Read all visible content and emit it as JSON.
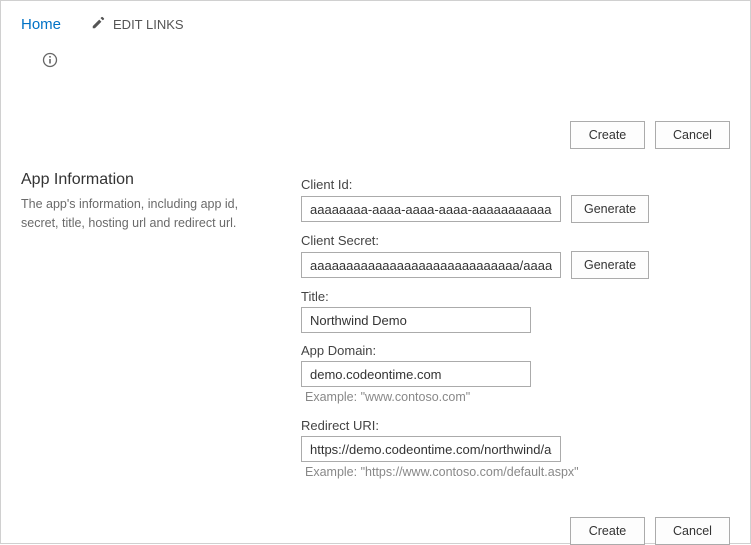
{
  "nav": {
    "home": "Home",
    "edit_links": "EDIT LINKS"
  },
  "buttons": {
    "create": "Create",
    "cancel": "Cancel",
    "generate": "Generate"
  },
  "section": {
    "title": "App Information",
    "description": "The app's information, including app id, secret, title, hosting url and redirect url."
  },
  "form": {
    "client_id": {
      "label": "Client Id:",
      "value": "aaaaaaaa-aaaa-aaaa-aaaa-aaaaaaaaaaaa"
    },
    "client_secret": {
      "label": "Client Secret:",
      "value": "aaaaaaaaaaaaaaaaaaaaaaaaaaaaa/aaaaaaaaaa"
    },
    "title": {
      "label": "Title:",
      "value": "Northwind Demo"
    },
    "app_domain": {
      "label": "App Domain:",
      "value": "demo.codeontime.com",
      "hint": "Example: \"www.contoso.com\""
    },
    "redirect_uri": {
      "label": "Redirect URI:",
      "value": "https://demo.codeontime.com/northwind/apps",
      "hint": "Example: \"https://www.contoso.com/default.aspx\""
    }
  }
}
